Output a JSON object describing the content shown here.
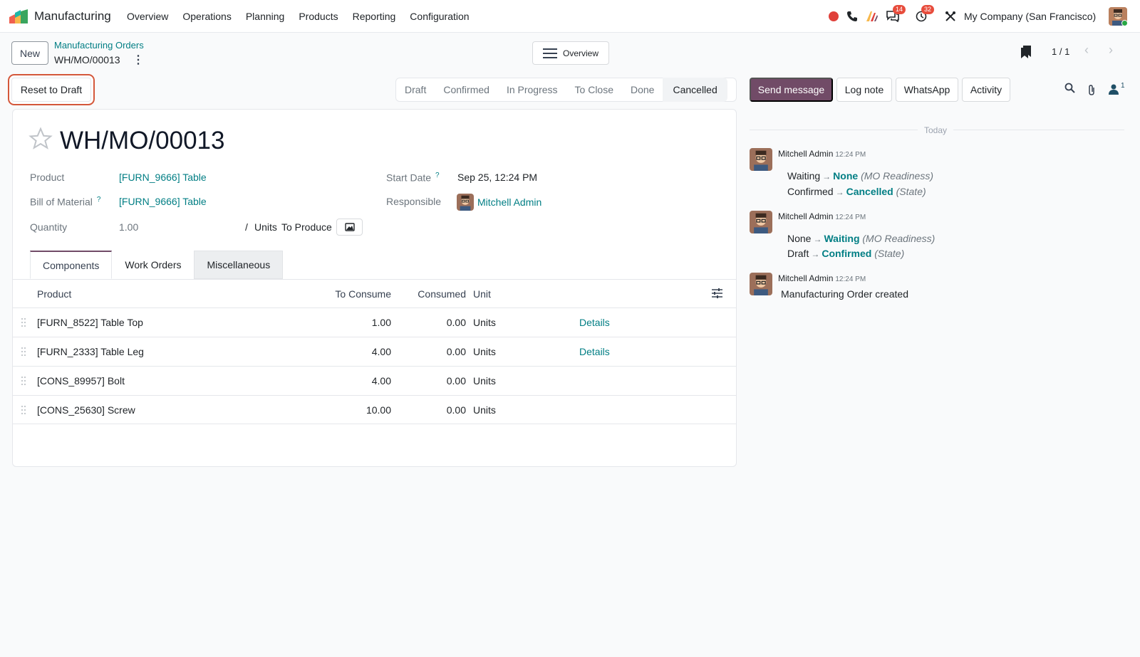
{
  "navbar": {
    "app_name": "Manufacturing",
    "menu": [
      "Overview",
      "Operations",
      "Planning",
      "Products",
      "Reporting",
      "Configuration"
    ],
    "discuss_badge": "14",
    "activity_badge": "32",
    "company": "My Company (San Francisco)"
  },
  "control": {
    "new_label": "New",
    "breadcrumb": "Manufacturing Orders",
    "record": "WH/MO/00013",
    "overview_label": "Overview",
    "pager": "1 / 1"
  },
  "actions": {
    "reset_label": "Reset to Draft"
  },
  "statusbar": {
    "steps": [
      "Draft",
      "Confirmed",
      "In Progress",
      "To Close",
      "Done",
      "Cancelled"
    ],
    "active": "Cancelled"
  },
  "chatter": {
    "send_message": "Send message",
    "log_note": "Log note",
    "whatsapp": "WhatsApp",
    "activity": "Activity",
    "followers_count": "1",
    "date_separator": "Today",
    "messages": [
      {
        "author": "Mitchell Admin",
        "time": "12:24 PM",
        "tracking": [
          {
            "old": "Waiting",
            "new": "None",
            "field": "(MO Readiness)"
          },
          {
            "old": "Confirmed",
            "new": "Cancelled",
            "field": "(State)"
          }
        ]
      },
      {
        "author": "Mitchell Admin",
        "time": "12:24 PM",
        "tracking": [
          {
            "old": "None",
            "new": "Waiting",
            "field": "(MO Readiness)"
          },
          {
            "old": "Draft",
            "new": "Confirmed",
            "field": "(State)"
          }
        ]
      },
      {
        "author": "Mitchell Admin",
        "time": "12:24 PM",
        "body": "Manufacturing Order created"
      }
    ]
  },
  "form": {
    "title": "WH/MO/00013",
    "product_label": "Product",
    "product_value": "[FURN_9666] Table",
    "bom_label": "Bill of Material",
    "bom_help": "?",
    "bom_value": "[FURN_9666] Table",
    "quantity_label": "Quantity",
    "quantity_value": "1.00",
    "quantity_sep": "/",
    "uom": "Units",
    "to_produce": "To Produce",
    "start_date_label": "Start Date",
    "start_date_help": "?",
    "start_date_value": "Sep 25, 12:24 PM",
    "responsible_label": "Responsible",
    "responsible_value": "Mitchell Admin",
    "tabs": [
      "Components",
      "Work Orders",
      "Miscellaneous"
    ],
    "table": {
      "headers": [
        "Product",
        "To Consume",
        "Consumed",
        "Unit"
      ],
      "rows": [
        {
          "product": "[FURN_8522] Table Top",
          "to_consume": "1.00",
          "consumed": "0.00",
          "unit": "Units",
          "details": "Details"
        },
        {
          "product": "[FURN_2333] Table Leg",
          "to_consume": "4.00",
          "consumed": "0.00",
          "unit": "Units",
          "details": "Details"
        },
        {
          "product": "[CONS_89957] Bolt",
          "to_consume": "4.00",
          "consumed": "0.00",
          "unit": "Units",
          "details": ""
        },
        {
          "product": "[CONS_25630] Screw",
          "to_consume": "10.00",
          "consumed": "0.00",
          "unit": "Units",
          "details": ""
        }
      ]
    }
  },
  "colors": {
    "brand": "#714b67",
    "link": "#017e84",
    "highlight": "#d4573a"
  }
}
